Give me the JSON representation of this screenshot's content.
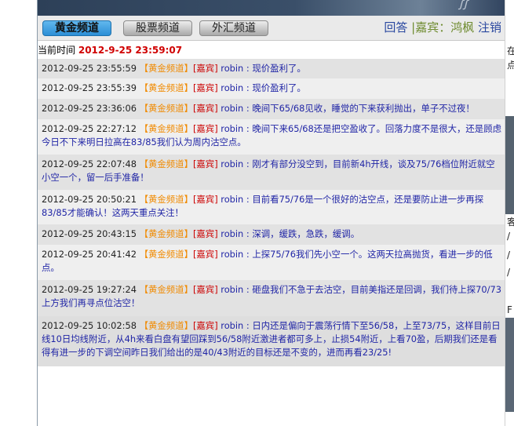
{
  "tabs": [
    {
      "label": "黄金频道",
      "active": true
    },
    {
      "label": "股票频道",
      "active": false
    },
    {
      "label": "外汇频道",
      "active": false
    }
  ],
  "user_bar": {
    "answer": "回答",
    "separator": "|",
    "guest_label": "嘉宾：鸿枫",
    "logout": "注销"
  },
  "time": {
    "label": "当前时间",
    "value": "2012-9-25 23:59:07"
  },
  "messages": [
    {
      "time": "2012-09-25 23:55:59",
      "channel": "【黄金频道】",
      "tag": "[嘉宾]",
      "user": "robin",
      "sep": " : ",
      "text": "现价盈利了。"
    },
    {
      "time": "2012-09-25 23:55:39",
      "channel": "【黄金频道】",
      "tag": "[嘉宾]",
      "user": "robin",
      "sep": " : ",
      "text": "现价盈利了。"
    },
    {
      "time": "2012-09-25 23:36:06",
      "channel": "【黄金频道】",
      "tag": "[嘉宾]",
      "user": "robin",
      "sep": " : ",
      "text": "晚间下65/68见收，睡觉的下来获利抛出，单子不过夜！"
    },
    {
      "time": "2012-09-25 22:27:12",
      "channel": "【黄金频道】",
      "tag": "[嘉宾]",
      "user": "robin",
      "sep": " : ",
      "text": "晚间下来65/68还是把空盈收了。回落力度不是很大，还是顾虑今日不下来明日拉高在83/85我们认为周内沽空点。"
    },
    {
      "time": "2012-09-25 22:07:48",
      "channel": "【黄金频道】",
      "tag": "[嘉宾]",
      "user": "robin",
      "sep": " : ",
      "text": "刚才有部分没空到，目前新4h开线，谈及75/76档位附近就空小空一个，留一后手准备！"
    },
    {
      "time": "2012-09-25 20:50:21",
      "channel": "【黄金频道】",
      "tag": "[嘉宾]",
      "user": "robin",
      "sep": " : ",
      "text": "目前看75/76是一个很好的沽空点，还是要防止进一步再探83/85才能确认！这两天重点关注！"
    },
    {
      "time": "2012-09-25 20:43:15",
      "channel": "【黄金频道】",
      "tag": "[嘉宾]",
      "user": "robin",
      "sep": " : ",
      "text": "深调，缓跌，急跌，缓调。"
    },
    {
      "time": "2012-09-25 20:41:42",
      "channel": "【黄金频道】",
      "tag": "[嘉宾]",
      "user": "robin",
      "sep": " : ",
      "text": "上探75/76我们先小空一个。这两天拉高抛货，看进一步的低点。"
    },
    {
      "time": "2012-09-25 19:27:24",
      "channel": "【黄金频道】",
      "tag": "[嘉宾]",
      "user": "robin",
      "sep": " : ",
      "text": "砸盘我们不急于去沽空，目前美指还是回调，我们待上探70/73上方我们再寻点位沽空！"
    },
    {
      "time": "2012-09-25 10:02:58",
      "channel": "【黄金频道】",
      "tag": "[嘉宾]",
      "user": "robin",
      "sep": " : ",
      "text": "日内还是偏向于震荡行情下至56/58，上至73/75，这样目前日线10日均线附近，从4h来看白盘有望回踩到56/58附近激进者都可多上，止损54附近，上看70盈，后期我们还是看得有进一步的下调空间昨日我们给出的是40/43附近的目标还是不变的，进而再看23/25!"
    }
  ],
  "right_panel": {
    "fragments": [
      "在",
      "点",
      "客",
      "/",
      "/",
      "/",
      "F"
    ]
  }
}
